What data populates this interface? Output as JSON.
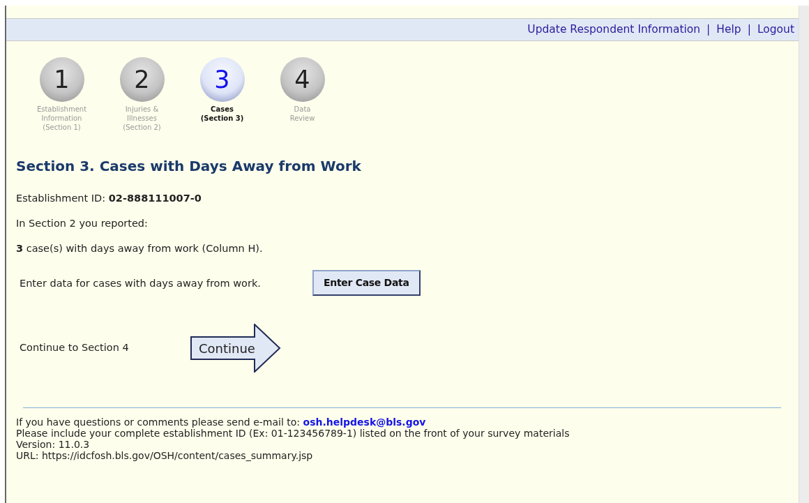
{
  "top_links": [
    {
      "label": "Update Respondent Information"
    },
    {
      "label": "Help"
    },
    {
      "label": "Logout"
    }
  ],
  "link_separator": "|",
  "steps": [
    {
      "number": "1",
      "label": "Establishment\nInformation\n(Section 1)",
      "selected": false
    },
    {
      "number": "2",
      "label": "Injuries &\nIllnesses\n(Section 2)",
      "selected": false
    },
    {
      "number": "3",
      "label": "Cases\n(Section 3)",
      "selected": true
    },
    {
      "number": "4",
      "label": "Data\nReview",
      "selected": false
    }
  ],
  "heading": "Section 3. Cases with Days Away from Work",
  "establishment_line": "Establishment ID: **02-888111007-0**",
  "intro": "In Section 2 you reported:",
  "summary": "**3** case(s) with days away from work (Column H).",
  "enter_prompt": "Enter data for cases with days away from work.",
  "enter_button": "Enter Case Data",
  "continue_prompt": "Continue to Section 4",
  "continue_button": "Continue",
  "footer": {
    "contact_text": "If you have questions or comments please send e-mail to:",
    "email": "osh.helpdesk@bls.gov",
    "lines": [
      "Please include your complete establishment ID (Ex: 01-123456789-1) listed on the front of your survey materials",
      "Version: 11.0.3",
      "URL: https://idcfosh.bls.gov/OSH/content/cases_summary.jsp"
    ]
  }
}
